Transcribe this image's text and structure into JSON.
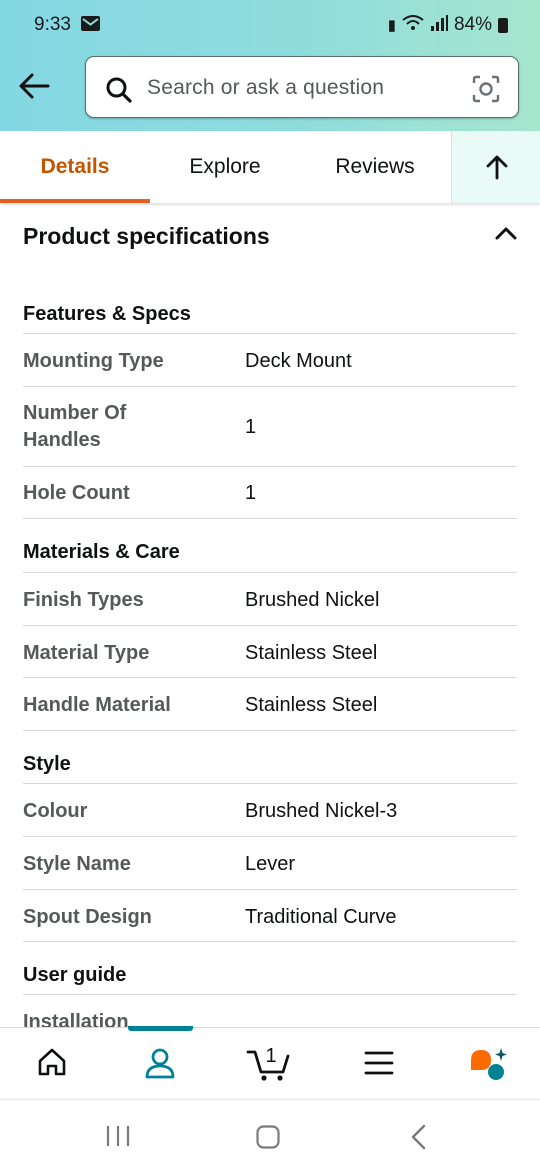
{
  "status_bar": {
    "time": "9:33",
    "battery": "84%"
  },
  "search": {
    "placeholder": "Search or ask a question"
  },
  "tabs": [
    {
      "label": "Details",
      "active": true
    },
    {
      "label": "Explore"
    },
    {
      "label": "Reviews"
    }
  ],
  "section": {
    "title": "Product specifications"
  },
  "groups": [
    {
      "title": "Features & Specs",
      "rows": [
        {
          "key": "Mounting Type",
          "value": "Deck Mount"
        },
        {
          "key": "Number Of Handles",
          "value": "1"
        },
        {
          "key": "Hole Count",
          "value": "1"
        }
      ]
    },
    {
      "title": "Materials & Care",
      "rows": [
        {
          "key": "Finish Types",
          "value": "Brushed Nickel"
        },
        {
          "key": "Material Type",
          "value": "Stainless Steel"
        },
        {
          "key": "Handle Material",
          "value": "Stainless Steel"
        }
      ]
    },
    {
      "title": "Style",
      "rows": [
        {
          "key": "Colour",
          "value": "Brushed Nickel-3"
        },
        {
          "key": "Style Name",
          "value": "Lever"
        },
        {
          "key": "Spout Design",
          "value": "Traditional Curve"
        }
      ]
    },
    {
      "title": "User guide",
      "rows": [
        {
          "key": "Installation",
          "value": ""
        }
      ]
    }
  ],
  "bottom_nav": {
    "cart_count": "1",
    "items": [
      "home-icon",
      "account-icon",
      "cart-icon",
      "menu-icon",
      "rufus-icon"
    ]
  },
  "colors": {
    "accent_orange": "#c45500",
    "teal": "#008296",
    "header_gradient_start": "#84d8e3",
    "header_gradient_end": "#a6e6cf"
  }
}
